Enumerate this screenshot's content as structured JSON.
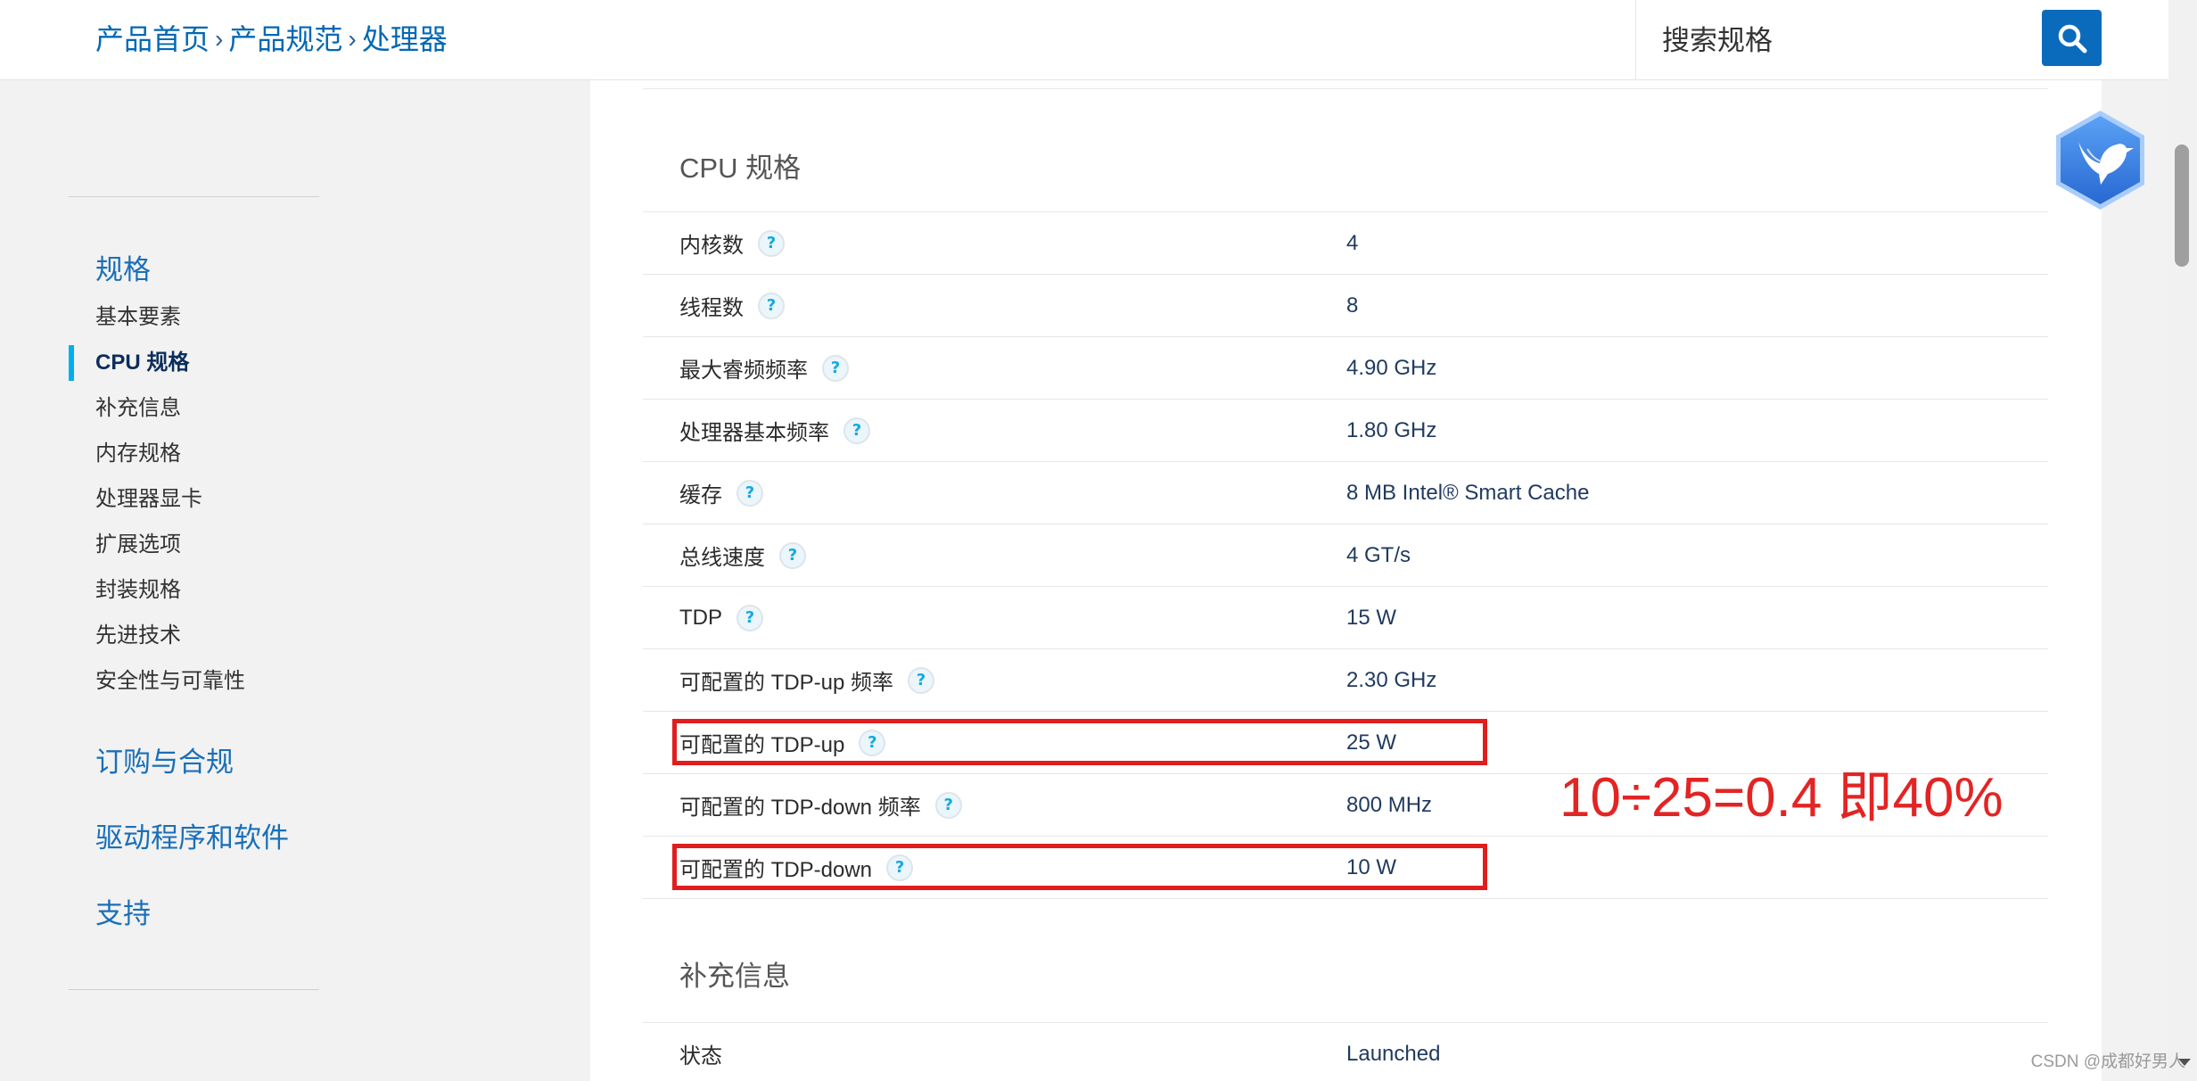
{
  "header": {
    "breadcrumb": [
      "产品首页",
      "产品规范",
      "处理器"
    ],
    "breadcrumb_separator": "›",
    "search_placeholder": "搜索规格"
  },
  "sidebar": {
    "spec_heading": "规格",
    "spec_items": [
      {
        "label": "基本要素",
        "active": false
      },
      {
        "label": "CPU 规格",
        "active": true
      },
      {
        "label": "补充信息",
        "active": false
      },
      {
        "label": "内存规格",
        "active": false
      },
      {
        "label": "处理器显卡",
        "active": false
      },
      {
        "label": "扩展选项",
        "active": false
      },
      {
        "label": "封装规格",
        "active": false
      },
      {
        "label": "先进技术",
        "active": false
      },
      {
        "label": "安全性与可靠性",
        "active": false
      }
    ],
    "sections": [
      "订购与合规",
      "驱动程序和软件",
      "支持"
    ]
  },
  "main": {
    "cpu_section": {
      "title": "CPU 规格",
      "rows": [
        {
          "label": "内核数",
          "value": "4",
          "highlighted": false
        },
        {
          "label": "线程数",
          "value": "8",
          "highlighted": false
        },
        {
          "label": "最大睿频频率",
          "value": "4.90 GHz",
          "highlighted": false
        },
        {
          "label": "处理器基本频率",
          "value": "1.80 GHz",
          "highlighted": false
        },
        {
          "label": "缓存",
          "value": "8 MB Intel® Smart Cache",
          "highlighted": false
        },
        {
          "label": "总线速度",
          "value": "4 GT/s",
          "highlighted": false
        },
        {
          "label": "TDP",
          "value": "15 W",
          "highlighted": false
        },
        {
          "label": "可配置的 TDP-up 频率",
          "value": "2.30 GHz",
          "highlighted": false
        },
        {
          "label": "可配置的 TDP-up",
          "value": "25 W",
          "highlighted": true
        },
        {
          "label": "可配置的 TDP-down 频率",
          "value": "800 MHz",
          "highlighted": false
        },
        {
          "label": "可配置的 TDP-down",
          "value": "10 W",
          "highlighted": true
        }
      ]
    },
    "supplement_section": {
      "title": "补充信息",
      "rows": [
        {
          "label": "状态",
          "value": "Launched"
        }
      ]
    }
  },
  "help_icon_glyph": "?",
  "annotation": {
    "text": "10÷25=0.4 即40%"
  },
  "watermark": "CSDN @成都好男人",
  "colors": {
    "brand_blue": "#0068b5",
    "accent_cyan": "#00aeef",
    "annotation_red": "#e02020",
    "sidebar_bg": "#f2f2f2",
    "panel_bg": "#ffffff"
  },
  "icons": {
    "search_button": "search-icon",
    "help": "help-icon",
    "floating_logo": "bird-hexagon-logo"
  }
}
